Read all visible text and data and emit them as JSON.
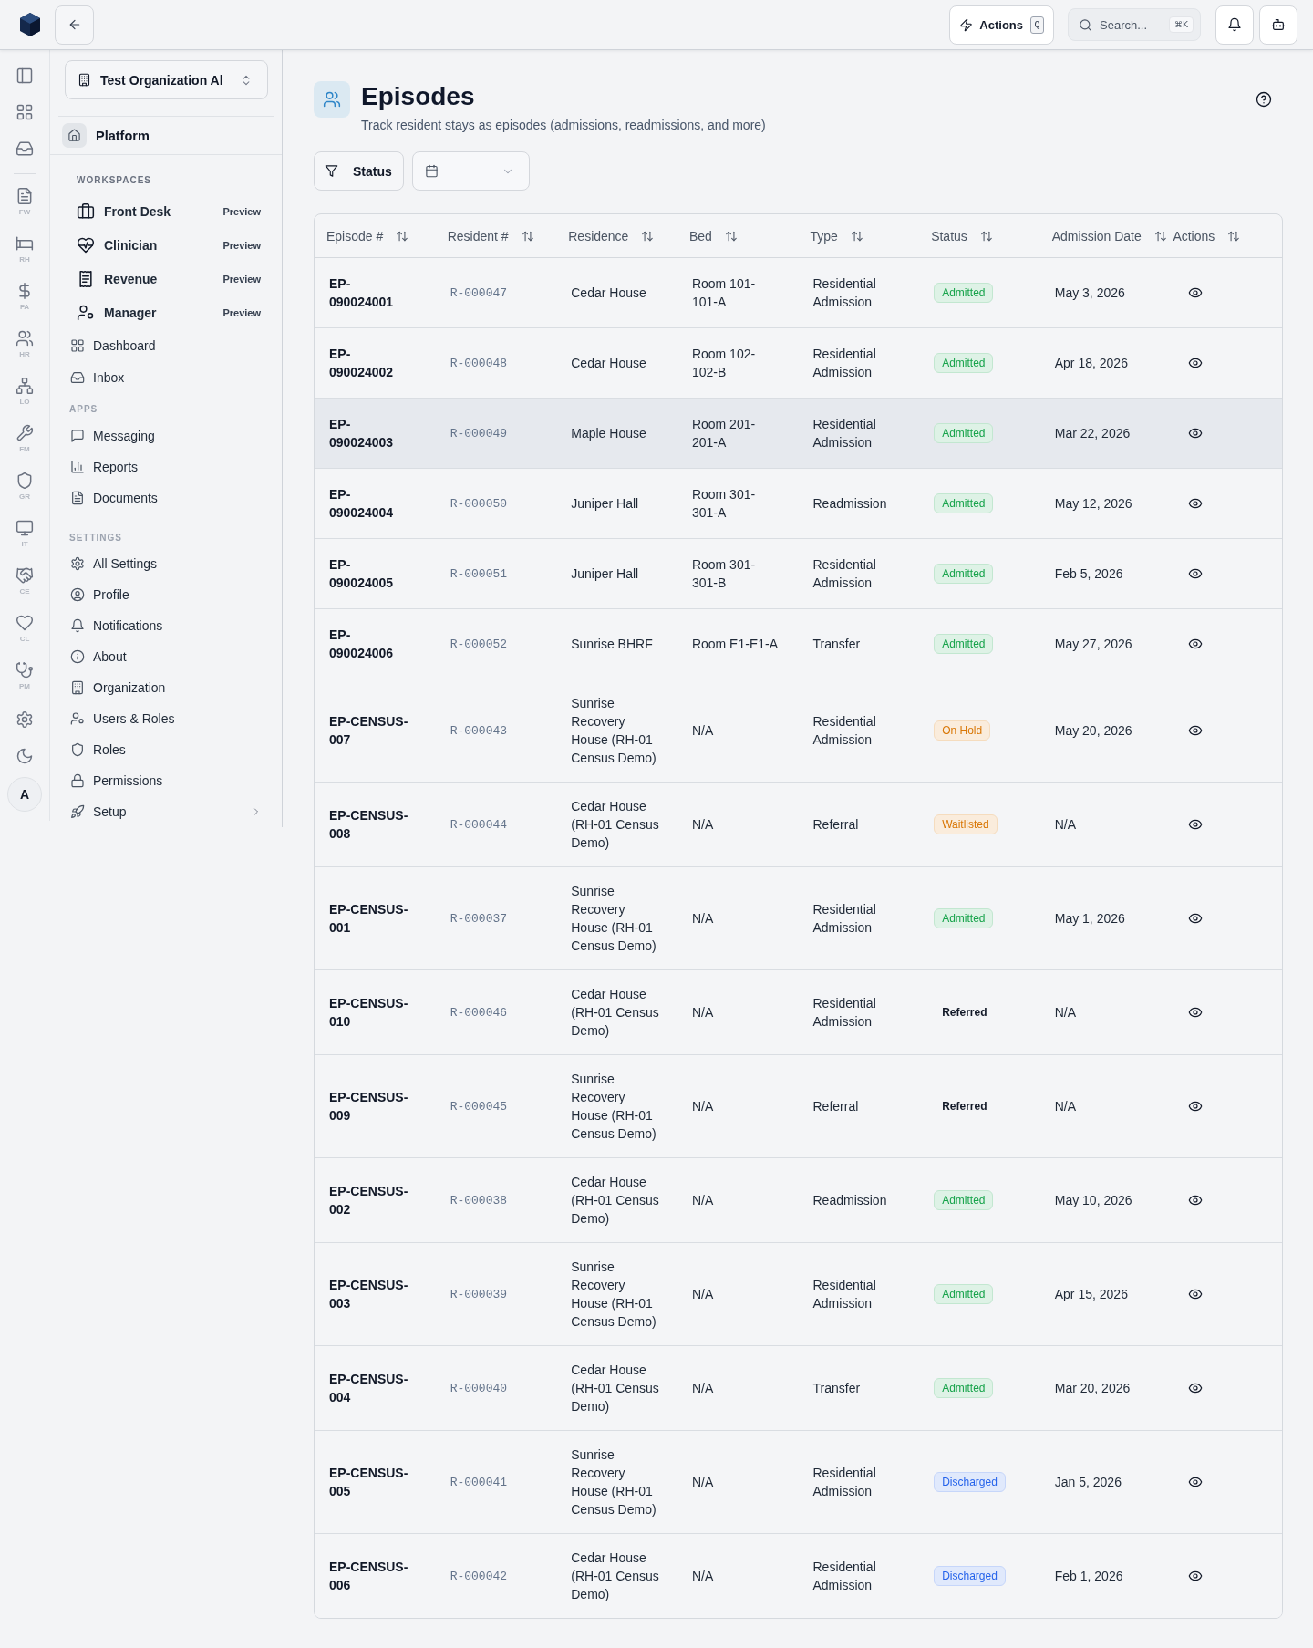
{
  "top_bar": {
    "actions": {
      "label": "Actions",
      "shortcut": "Q"
    },
    "search": {
      "placeholder": "Search...",
      "shortcut": "⌘K"
    }
  },
  "icon_rail": {
    "modules": [
      {
        "label": "FW"
      },
      {
        "label": "RH"
      },
      {
        "label": "FA"
      },
      {
        "label": "HR"
      },
      {
        "label": "LO"
      },
      {
        "label": "FM"
      },
      {
        "label": "GR"
      },
      {
        "label": "IT"
      },
      {
        "label": "CE"
      },
      {
        "label": "CL"
      },
      {
        "label": "PM"
      }
    ],
    "avatar": "A"
  },
  "sidebar": {
    "organization": "Test Organization Al",
    "platform": "Platform",
    "workspaces": {
      "heading": "WORKSPACES",
      "items": [
        {
          "label": "Front Desk",
          "badge": "Preview"
        },
        {
          "label": "Clinician",
          "badge": "Preview"
        },
        {
          "label": "Revenue",
          "badge": "Preview"
        },
        {
          "label": "Manager",
          "badge": "Preview"
        }
      ]
    },
    "groups": [
      {
        "items": [
          {
            "label": "Dashboard"
          },
          {
            "label": "Inbox"
          }
        ]
      },
      {
        "heading": "APPS",
        "items": [
          {
            "label": "Messaging"
          },
          {
            "label": "Reports"
          },
          {
            "label": "Documents"
          }
        ]
      },
      {
        "heading": "SETTINGS",
        "items": [
          {
            "label": "All Settings",
            "kind": "link"
          },
          {
            "label": "Profile",
            "kind": "link"
          },
          {
            "label": "Notifications",
            "kind": "link"
          },
          {
            "label": "About",
            "kind": "link"
          },
          {
            "label": "Organization",
            "kind": "link"
          },
          {
            "label": "Users & Roles",
            "kind": "link"
          },
          {
            "label": "Roles",
            "kind": "link"
          },
          {
            "label": "Permissions",
            "kind": "link"
          },
          {
            "label": "Setup",
            "kind": "submenu"
          }
        ]
      }
    ]
  },
  "page": {
    "title": "Episodes",
    "subtitle": "Track resident stays as episodes (admissions, readmissions, and more)",
    "filters": {
      "status": "Status"
    }
  },
  "table": {
    "columns": [
      {
        "label": "Episode #"
      },
      {
        "label": "Resident #"
      },
      {
        "label": "Residence"
      },
      {
        "label": "Bed"
      },
      {
        "label": "Type"
      },
      {
        "label": "Status"
      },
      {
        "label": "Admission Date"
      },
      {
        "label": "Actions"
      }
    ],
    "rows": [
      {
        "episode": "EP-090024001",
        "resident": "R-000047",
        "residence": "Cedar House",
        "bed": "Room 101-101-A",
        "type": "Residential Admission",
        "status": {
          "label": "Admitted",
          "kind": "badge",
          "color": "#16a34a"
        },
        "admission_date": "May 3, 2026",
        "hovered": false
      },
      {
        "episode": "EP-090024002",
        "resident": "R-000048",
        "residence": "Cedar House",
        "bed": "Room 102-102-B",
        "type": "Residential Admission",
        "status": {
          "label": "Admitted",
          "kind": "badge",
          "color": "#16a34a"
        },
        "admission_date": "Apr 18, 2026",
        "hovered": false
      },
      {
        "episode": "EP-090024003",
        "resident": "R-000049",
        "residence": "Maple House",
        "bed": "Room 201-201-A",
        "type": "Residential Admission",
        "status": {
          "label": "Admitted",
          "kind": "badge",
          "color": "#16a34a"
        },
        "admission_date": "Mar 22, 2026",
        "hovered": true
      },
      {
        "episode": "EP-090024004",
        "resident": "R-000050",
        "residence": "Juniper Hall",
        "bed": "Room 301-301-A",
        "type": "Readmission",
        "status": {
          "label": "Admitted",
          "kind": "badge",
          "color": "#16a34a"
        },
        "admission_date": "May 12, 2026",
        "hovered": false
      },
      {
        "episode": "EP-090024005",
        "resident": "R-000051",
        "residence": "Juniper Hall",
        "bed": "Room 301-301-B",
        "type": "Residential Admission",
        "status": {
          "label": "Admitted",
          "kind": "badge",
          "color": "#16a34a"
        },
        "admission_date": "Feb 5, 2026",
        "hovered": false
      },
      {
        "episode": "EP-090024006",
        "resident": "R-000052",
        "residence": "Sunrise BHRF",
        "bed": "Room E1-E1-A",
        "type": "Transfer",
        "status": {
          "label": "Admitted",
          "kind": "badge",
          "color": "#16a34a"
        },
        "admission_date": "May 27, 2026",
        "hovered": false
      },
      {
        "episode": "EP-CENSUS-007",
        "resident": "R-000043",
        "residence": "Sunrise Recovery House (RH-01 Census Demo)",
        "bed": "N/A",
        "type": "Residential Admission",
        "status": {
          "label": "On Hold",
          "kind": "badge",
          "color": "#d97706"
        },
        "admission_date": "May 20, 2026",
        "hovered": false
      },
      {
        "episode": "EP-CENSUS-008",
        "resident": "R-000044",
        "residence": "Cedar House (RH-01 Census Demo)",
        "bed": "N/A",
        "type": "Referral",
        "status": {
          "label": "Waitlisted",
          "kind": "badge",
          "color": "#d97706"
        },
        "admission_date": "N/A",
        "hovered": false
      },
      {
        "episode": "EP-CENSUS-001",
        "resident": "R-000037",
        "residence": "Sunrise Recovery House (RH-01 Census Demo)",
        "bed": "N/A",
        "type": "Residential Admission",
        "status": {
          "label": "Admitted",
          "kind": "badge",
          "color": "#16a34a"
        },
        "admission_date": "May 1, 2026",
        "hovered": false
      },
      {
        "episode": "EP-CENSUS-010",
        "resident": "R-000046",
        "residence": "Cedar House (RH-01 Census Demo)",
        "bed": "N/A",
        "type": "Residential Admission",
        "status": {
          "label": "Referred",
          "kind": "plain",
          "color": "#111827"
        },
        "admission_date": "N/A",
        "hovered": false
      },
      {
        "episode": "EP-CENSUS-009",
        "resident": "R-000045",
        "residence": "Sunrise Recovery House (RH-01 Census Demo)",
        "bed": "N/A",
        "type": "Referral",
        "status": {
          "label": "Referred",
          "kind": "plain",
          "color": "#111827"
        },
        "admission_date": "N/A",
        "hovered": false
      },
      {
        "episode": "EP-CENSUS-002",
        "resident": "R-000038",
        "residence": "Cedar House (RH-01 Census Demo)",
        "bed": "N/A",
        "type": "Readmission",
        "status": {
          "label": "Admitted",
          "kind": "badge",
          "color": "#16a34a"
        },
        "admission_date": "May 10, 2026",
        "hovered": false
      },
      {
        "episode": "EP-CENSUS-003",
        "resident": "R-000039",
        "residence": "Sunrise Recovery House (RH-01 Census Demo)",
        "bed": "N/A",
        "type": "Residential Admission",
        "status": {
          "label": "Admitted",
          "kind": "badge",
          "color": "#16a34a"
        },
        "admission_date": "Apr 15, 2026",
        "hovered": false
      },
      {
        "episode": "EP-CENSUS-004",
        "resident": "R-000040",
        "residence": "Cedar House (RH-01 Census Demo)",
        "bed": "N/A",
        "type": "Transfer",
        "status": {
          "label": "Admitted",
          "kind": "badge",
          "color": "#16a34a"
        },
        "admission_date": "Mar 20, 2026",
        "hovered": false
      },
      {
        "episode": "EP-CENSUS-005",
        "resident": "R-000041",
        "residence": "Sunrise Recovery House (RH-01 Census Demo)",
        "bed": "N/A",
        "type": "Residential Admission",
        "status": {
          "label": "Discharged",
          "kind": "badge",
          "color": "#2563eb"
        },
        "admission_date": "Jan 5, 2026",
        "hovered": false
      },
      {
        "episode": "EP-CENSUS-006",
        "resident": "R-000042",
        "residence": "Cedar House (RH-01 Census Demo)",
        "bed": "N/A",
        "type": "Residential Admission",
        "status": {
          "label": "Discharged",
          "kind": "badge",
          "color": "#2563eb"
        },
        "admission_date": "Feb 1, 2026",
        "hovered": false
      }
    ]
  }
}
